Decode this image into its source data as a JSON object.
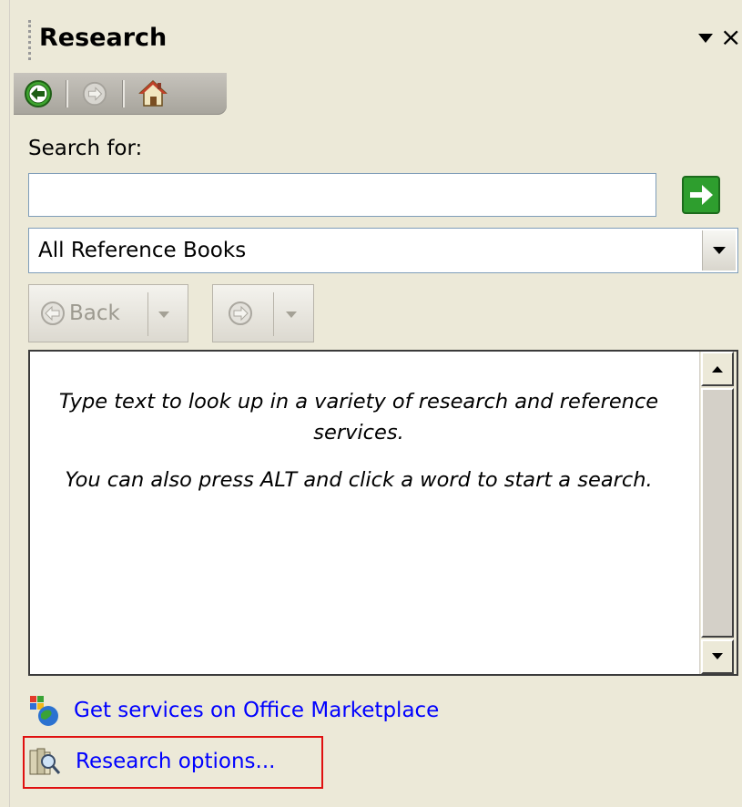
{
  "pane": {
    "title": "Research",
    "dropdown_icon": "dropdown-arrow-icon",
    "close_icon": "×"
  },
  "nav": {
    "back_icon": "back-circle-icon",
    "forward_icon": "forward-circle-icon",
    "home_icon": "home-icon"
  },
  "search": {
    "label": "Search for:",
    "value": "",
    "placeholder": "",
    "go_icon": "green-arrow-icon"
  },
  "source": {
    "selected": "All Reference Books"
  },
  "toolbar": {
    "back_label": "Back"
  },
  "results": {
    "line1": "Type text to look up in a variety of research and reference services.",
    "line2": "You can also press ALT and click a word to start a search."
  },
  "links": {
    "marketplace": "Get services on Office Marketplace",
    "options": "Research options..."
  },
  "colors": {
    "link": "#0000ff",
    "highlight": "#e01010",
    "go_green": "#2e9e2e"
  }
}
